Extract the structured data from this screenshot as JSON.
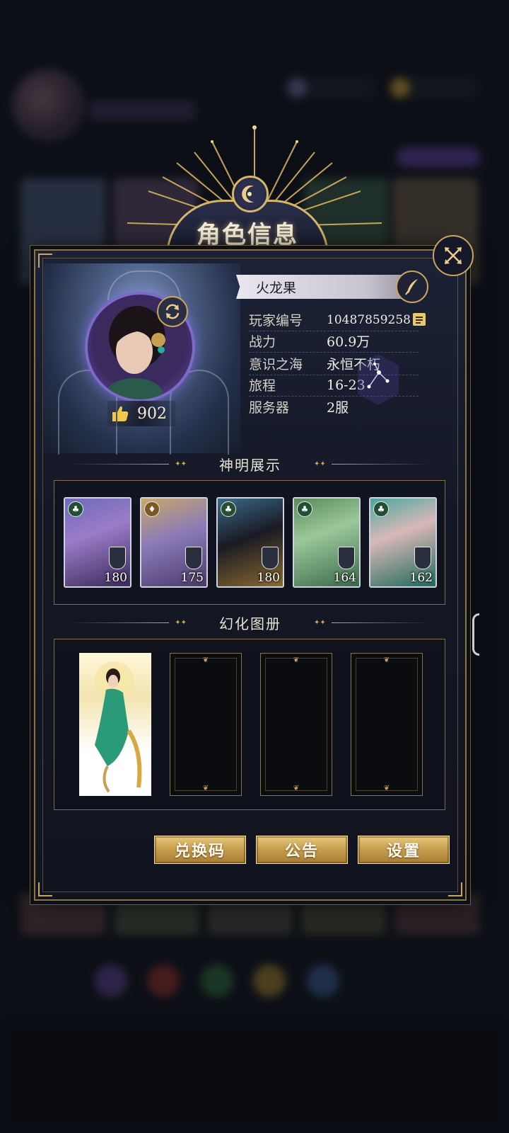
{
  "title": "角色信息",
  "player": {
    "name": "火龙果",
    "likes": "902"
  },
  "info_rows": [
    {
      "label": "玩家编号",
      "value": "10487859258"
    },
    {
      "label": "战力",
      "value": "60.9万"
    },
    {
      "label": "意识之海",
      "value": "永恒不朽"
    },
    {
      "label": "旅程",
      "value": "16-23"
    },
    {
      "label": "服务器",
      "value": "2服"
    }
  ],
  "sections": {
    "gods": "神明展示",
    "gallery": "幻化图册"
  },
  "god_cards": [
    {
      "level": "180",
      "suit": "club"
    },
    {
      "level": "175",
      "suit": "diamond"
    },
    {
      "level": "180",
      "suit": "club"
    },
    {
      "level": "164",
      "suit": "club"
    },
    {
      "level": "162",
      "suit": "club"
    }
  ],
  "buttons": {
    "redeem": "兑换码",
    "notice": "公告",
    "settings": "设置"
  },
  "colors": {
    "accent_gold": "#c9a65c",
    "panel_bg": "#141826",
    "button_gold": "#c9a050"
  },
  "icons": [
    "close-icon",
    "refresh-icon",
    "thumbs-up-icon",
    "edit-quill-icon",
    "copy-icon",
    "club-suit-icon"
  ]
}
